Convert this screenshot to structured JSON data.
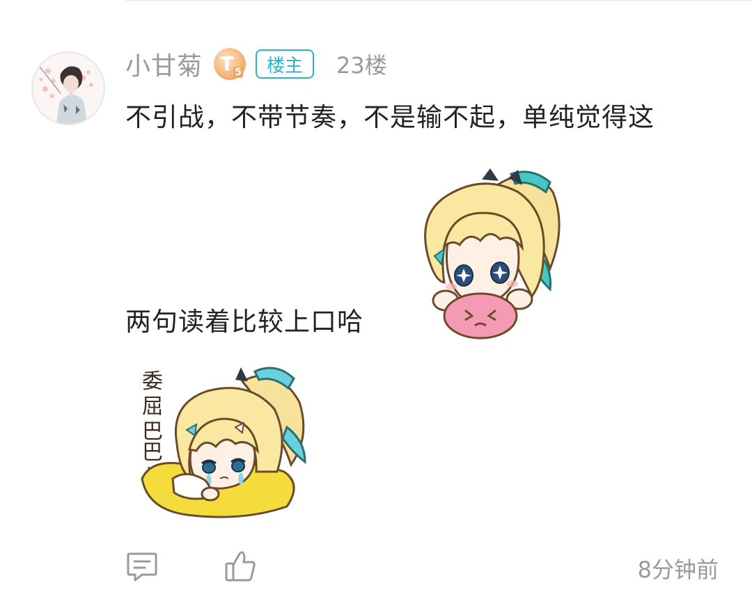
{
  "post": {
    "username": "小甘菊",
    "level_badge": {
      "letter": "T",
      "number": "5"
    },
    "owner_tag": "楼主",
    "floor": "23楼",
    "line1": "不引战，不带节奏，不是输不起，单纯觉得这",
    "line2": "两句读着比较上口哈",
    "sticker2_caption": "委屈巴巴…"
  },
  "footer": {
    "time": "8分钟前"
  },
  "colors": {
    "accent": "#2bb3c9",
    "meta_text": "#9a9a9a",
    "body_text": "#222222"
  },
  "icons": {
    "reply": "comment-icon",
    "like": "thumbs-up-icon"
  }
}
